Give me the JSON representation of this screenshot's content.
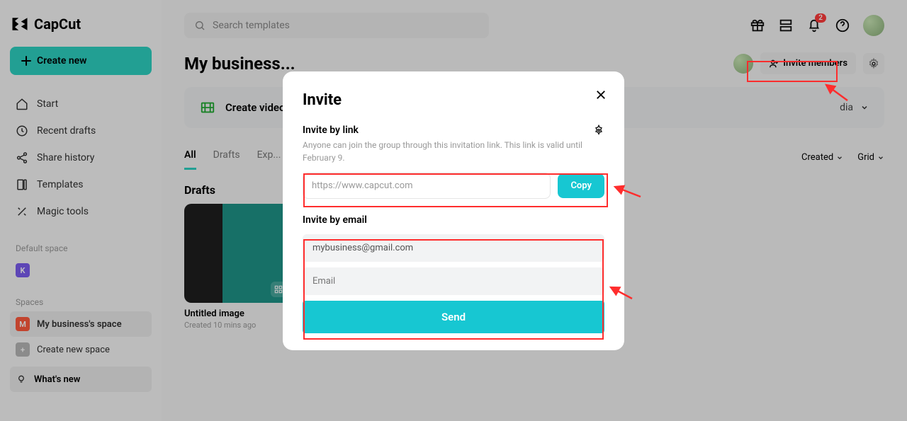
{
  "brand": "CapCut",
  "search_placeholder": "Search templates",
  "create_button": "Create new",
  "nav": {
    "items": [
      {
        "label": "Start"
      },
      {
        "label": "Recent drafts"
      },
      {
        "label": "Share history"
      },
      {
        "label": "Templates"
      },
      {
        "label": "Magic tools"
      }
    ]
  },
  "sidebar": {
    "default_space_label": "Default space",
    "default_space_initial": "K",
    "spaces_label": "Spaces",
    "spaces": [
      {
        "label": "My business's space",
        "initial": "M"
      },
      {
        "label": "Create new space",
        "initial": "+"
      }
    ],
    "whats_new": "What's new"
  },
  "notifications_count": "2",
  "page": {
    "title": "My business...",
    "invite_members": "Invite members",
    "create_video": "Create video",
    "dropdown_label": "dia",
    "tabs": [
      "All",
      "Drafts",
      "Exp..."
    ],
    "sort_label": "Created",
    "view_label": "Grid",
    "section_drafts": "Drafts",
    "draft": {
      "title": "Untitled image",
      "subtitle": "Created 10 mins ago"
    }
  },
  "modal": {
    "title": "Invite",
    "by_link_label": "Invite by link",
    "by_link_help": "Anyone can join the group through this invitation link. This link is valid until February 9.",
    "link_value": "https://www.capcut.com",
    "copy": "Copy",
    "by_email_label": "Invite by email",
    "email_value": "mybusiness@gmail.com",
    "email_placeholder": "Email",
    "send": "Send"
  }
}
